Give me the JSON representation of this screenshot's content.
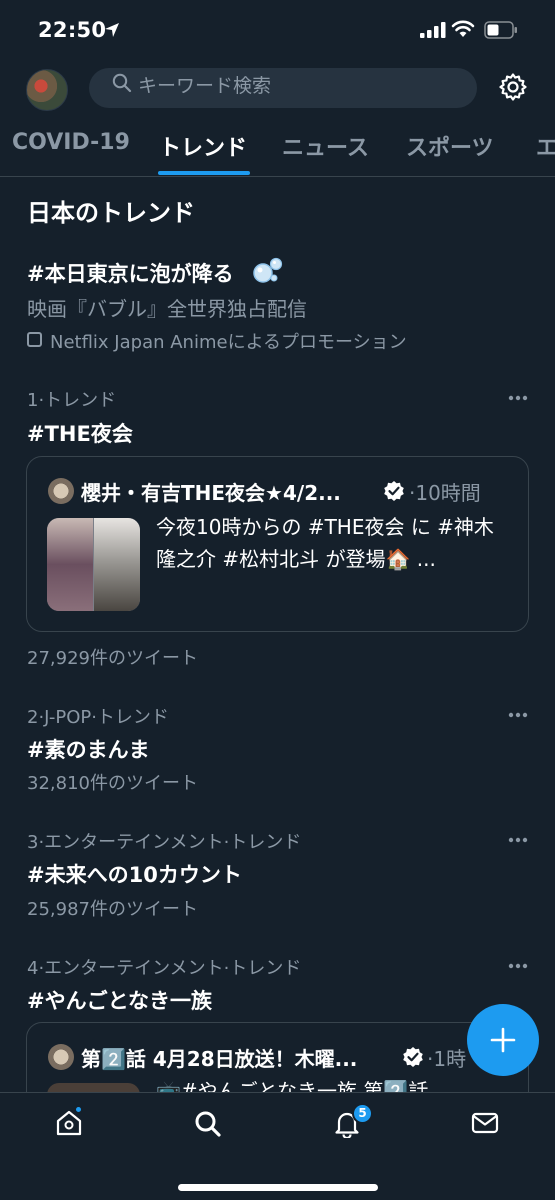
{
  "status_bar": {
    "time": "22:50"
  },
  "header": {
    "search_placeholder": "キーワード検索"
  },
  "tabs": [
    {
      "label": "COVID-19"
    },
    {
      "label": "トレンド"
    },
    {
      "label": "ニュース"
    },
    {
      "label": "スポーツ"
    },
    {
      "label": "エ"
    }
  ],
  "section_title": "日本のトレンド",
  "promoted": {
    "title": "#本日東京に泡が降る",
    "subtitle": "映画『バブル』全世界独占配信",
    "label": "Netflix Japan Animeによるプロモーション"
  },
  "trends": [
    {
      "meta": "1·トレンド",
      "title": "#THE夜会",
      "tweet": {
        "author": "櫻井・有吉THE夜会★4/2...",
        "time": "·10時間",
        "text": "今夜10時からの #THE夜会 に #神木隆之介 #松村北斗 が登場🏠 ..."
      },
      "count": "27,929件のツイート"
    },
    {
      "meta": "2·J-POP·トレンド",
      "title": "#素のまんま",
      "count": "32,810件のツイート"
    },
    {
      "meta": "3·エンターテインメント·トレンド",
      "title": "#未来への10カウント",
      "count": "25,987件のツイート"
    },
    {
      "meta": "4·エンターテインメント·トレンド",
      "title": "#やんごとなき一族",
      "tweet": {
        "author": "第2️⃣話 4月28日放送！木曜...",
        "time": "·1時",
        "text": "📺#やんごとなき一族 第2️⃣話"
      }
    }
  ],
  "bottom_nav": {
    "notification_count": "5"
  },
  "colors": {
    "background": "#15202b",
    "accent": "#1d9bf0",
    "secondary_text": "#8b98a5",
    "border": "#38444d"
  }
}
